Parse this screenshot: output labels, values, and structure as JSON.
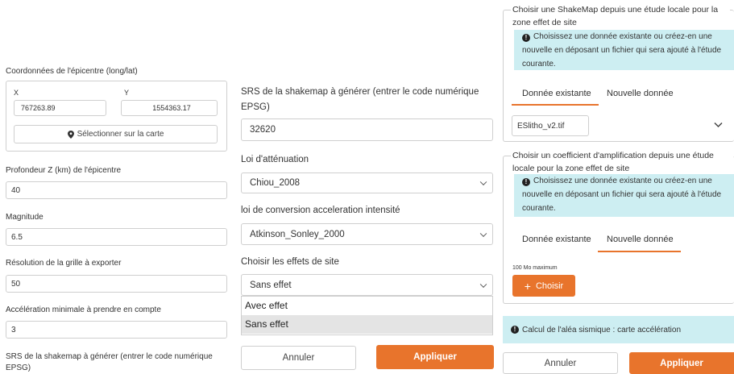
{
  "left": {
    "coords_label": "Coordonnées de l'épicentre (long/lat)",
    "x_label": "X",
    "y_label": "Y",
    "x_value": "767263.89",
    "y_value": "1554363.17",
    "select_on_map": "Sélectionner sur la carte",
    "depth_label": "Profondeur Z (km) de l'épicentre",
    "depth_value": "40",
    "magnitude_label": "Magnitude",
    "magnitude_value": "6.5",
    "resolution_label": "Résolution de la grille à exporter",
    "resolution_value": "50",
    "accel_label": "Accélération minimale à prendre en compte",
    "accel_value": "3",
    "srs_label": "SRS de la shakemap à générer (entrer le code numérique EPSG)"
  },
  "middle": {
    "srs_label": "SRS de la shakemap à générer (entrer le code numérique EPSG)",
    "srs_value": "32620",
    "attenuation_label": "Loi d'atténuation",
    "attenuation_value": "Chiou_2008",
    "conversion_label": "loi de conversion acceleration intensité",
    "conversion_value": "Atkinson_Sonley_2000",
    "site_effects_label": "Choisir les effets de site",
    "site_effects_value": "Sans effet",
    "site_effects_options": [
      "Avec effet",
      "Sans effet"
    ],
    "cancel": "Annuler",
    "apply": "Appliquer"
  },
  "right": {
    "shakemap_title": "Choisir une ShakeMap depuis une étude locale pour la zone effet de site",
    "shakemap_info": "Choisissez une donnée existante ou créez-en une nouvelle en déposant un fichier qui sera ajouté à l'étude courante.",
    "tab_existing": "Donnée existante",
    "tab_new": "Nouvelle donnée",
    "shakemap_file": "ESlitho_v2.tif",
    "coef_title": "Choisir un coefficient d'amplification depuis une étude locale pour la zone effet de site",
    "coef_info": "Choisissez une donnée existante ou créez-en une nouvelle en déposant un fichier qui sera ajouté à l'étude courante.",
    "max_size": "100 Mo maximum",
    "choose": "Choisir",
    "calc_info": "Calcul de l'aléa sismique : carte accélération",
    "cancel": "Annuler",
    "apply": "Appliquer"
  },
  "colors": {
    "accent": "#e8742c",
    "info_bg": "#cdeef2"
  }
}
